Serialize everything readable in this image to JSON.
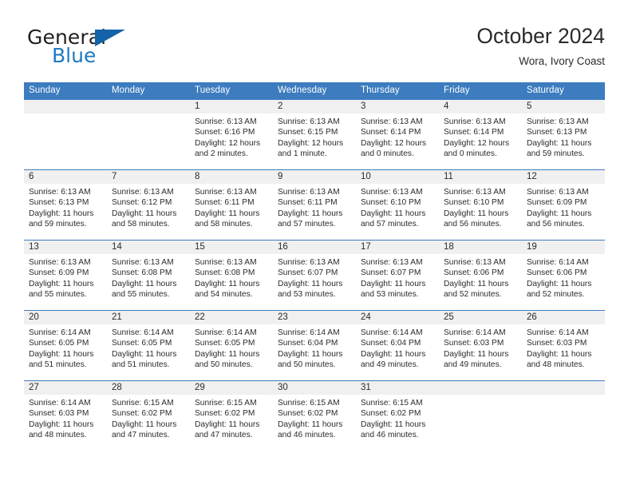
{
  "brand": {
    "name_part1": "General",
    "name_part2": "Blue",
    "triangle_color": "#1263a8",
    "blue_color": "#1e7ac4"
  },
  "header": {
    "month_title": "October 2024",
    "location": "Wora, Ivory Coast"
  },
  "theme": {
    "header_bar_color": "#3c7cbf",
    "daynum_band_color": "#f0f0f0",
    "text_color": "#2b2b2b"
  },
  "weekday_headers": [
    "Sunday",
    "Monday",
    "Tuesday",
    "Wednesday",
    "Thursday",
    "Friday",
    "Saturday"
  ],
  "weeks": [
    [
      {
        "day": "",
        "sunrise": "",
        "sunset": "",
        "daylight_line1": "",
        "daylight_line2": "",
        "empty": true
      },
      {
        "day": "",
        "sunrise": "",
        "sunset": "",
        "daylight_line1": "",
        "daylight_line2": "",
        "empty": true
      },
      {
        "day": "1",
        "sunrise": "Sunrise: 6:13 AM",
        "sunset": "Sunset: 6:16 PM",
        "daylight_line1": "Daylight: 12 hours",
        "daylight_line2": "and 2 minutes."
      },
      {
        "day": "2",
        "sunrise": "Sunrise: 6:13 AM",
        "sunset": "Sunset: 6:15 PM",
        "daylight_line1": "Daylight: 12 hours",
        "daylight_line2": "and 1 minute."
      },
      {
        "day": "3",
        "sunrise": "Sunrise: 6:13 AM",
        "sunset": "Sunset: 6:14 PM",
        "daylight_line1": "Daylight: 12 hours",
        "daylight_line2": "and 0 minutes."
      },
      {
        "day": "4",
        "sunrise": "Sunrise: 6:13 AM",
        "sunset": "Sunset: 6:14 PM",
        "daylight_line1": "Daylight: 12 hours",
        "daylight_line2": "and 0 minutes."
      },
      {
        "day": "5",
        "sunrise": "Sunrise: 6:13 AM",
        "sunset": "Sunset: 6:13 PM",
        "daylight_line1": "Daylight: 11 hours",
        "daylight_line2": "and 59 minutes."
      }
    ],
    [
      {
        "day": "6",
        "sunrise": "Sunrise: 6:13 AM",
        "sunset": "Sunset: 6:13 PM",
        "daylight_line1": "Daylight: 11 hours",
        "daylight_line2": "and 59 minutes."
      },
      {
        "day": "7",
        "sunrise": "Sunrise: 6:13 AM",
        "sunset": "Sunset: 6:12 PM",
        "daylight_line1": "Daylight: 11 hours",
        "daylight_line2": "and 58 minutes."
      },
      {
        "day": "8",
        "sunrise": "Sunrise: 6:13 AM",
        "sunset": "Sunset: 6:11 PM",
        "daylight_line1": "Daylight: 11 hours",
        "daylight_line2": "and 58 minutes."
      },
      {
        "day": "9",
        "sunrise": "Sunrise: 6:13 AM",
        "sunset": "Sunset: 6:11 PM",
        "daylight_line1": "Daylight: 11 hours",
        "daylight_line2": "and 57 minutes."
      },
      {
        "day": "10",
        "sunrise": "Sunrise: 6:13 AM",
        "sunset": "Sunset: 6:10 PM",
        "daylight_line1": "Daylight: 11 hours",
        "daylight_line2": "and 57 minutes."
      },
      {
        "day": "11",
        "sunrise": "Sunrise: 6:13 AM",
        "sunset": "Sunset: 6:10 PM",
        "daylight_line1": "Daylight: 11 hours",
        "daylight_line2": "and 56 minutes."
      },
      {
        "day": "12",
        "sunrise": "Sunrise: 6:13 AM",
        "sunset": "Sunset: 6:09 PM",
        "daylight_line1": "Daylight: 11 hours",
        "daylight_line2": "and 56 minutes."
      }
    ],
    [
      {
        "day": "13",
        "sunrise": "Sunrise: 6:13 AM",
        "sunset": "Sunset: 6:09 PM",
        "daylight_line1": "Daylight: 11 hours",
        "daylight_line2": "and 55 minutes."
      },
      {
        "day": "14",
        "sunrise": "Sunrise: 6:13 AM",
        "sunset": "Sunset: 6:08 PM",
        "daylight_line1": "Daylight: 11 hours",
        "daylight_line2": "and 55 minutes."
      },
      {
        "day": "15",
        "sunrise": "Sunrise: 6:13 AM",
        "sunset": "Sunset: 6:08 PM",
        "daylight_line1": "Daylight: 11 hours",
        "daylight_line2": "and 54 minutes."
      },
      {
        "day": "16",
        "sunrise": "Sunrise: 6:13 AM",
        "sunset": "Sunset: 6:07 PM",
        "daylight_line1": "Daylight: 11 hours",
        "daylight_line2": "and 53 minutes."
      },
      {
        "day": "17",
        "sunrise": "Sunrise: 6:13 AM",
        "sunset": "Sunset: 6:07 PM",
        "daylight_line1": "Daylight: 11 hours",
        "daylight_line2": "and 53 minutes."
      },
      {
        "day": "18",
        "sunrise": "Sunrise: 6:13 AM",
        "sunset": "Sunset: 6:06 PM",
        "daylight_line1": "Daylight: 11 hours",
        "daylight_line2": "and 52 minutes."
      },
      {
        "day": "19",
        "sunrise": "Sunrise: 6:14 AM",
        "sunset": "Sunset: 6:06 PM",
        "daylight_line1": "Daylight: 11 hours",
        "daylight_line2": "and 52 minutes."
      }
    ],
    [
      {
        "day": "20",
        "sunrise": "Sunrise: 6:14 AM",
        "sunset": "Sunset: 6:05 PM",
        "daylight_line1": "Daylight: 11 hours",
        "daylight_line2": "and 51 minutes."
      },
      {
        "day": "21",
        "sunrise": "Sunrise: 6:14 AM",
        "sunset": "Sunset: 6:05 PM",
        "daylight_line1": "Daylight: 11 hours",
        "daylight_line2": "and 51 minutes."
      },
      {
        "day": "22",
        "sunrise": "Sunrise: 6:14 AM",
        "sunset": "Sunset: 6:05 PM",
        "daylight_line1": "Daylight: 11 hours",
        "daylight_line2": "and 50 minutes."
      },
      {
        "day": "23",
        "sunrise": "Sunrise: 6:14 AM",
        "sunset": "Sunset: 6:04 PM",
        "daylight_line1": "Daylight: 11 hours",
        "daylight_line2": "and 50 minutes."
      },
      {
        "day": "24",
        "sunrise": "Sunrise: 6:14 AM",
        "sunset": "Sunset: 6:04 PM",
        "daylight_line1": "Daylight: 11 hours",
        "daylight_line2": "and 49 minutes."
      },
      {
        "day": "25",
        "sunrise": "Sunrise: 6:14 AM",
        "sunset": "Sunset: 6:03 PM",
        "daylight_line1": "Daylight: 11 hours",
        "daylight_line2": "and 49 minutes."
      },
      {
        "day": "26",
        "sunrise": "Sunrise: 6:14 AM",
        "sunset": "Sunset: 6:03 PM",
        "daylight_line1": "Daylight: 11 hours",
        "daylight_line2": "and 48 minutes."
      }
    ],
    [
      {
        "day": "27",
        "sunrise": "Sunrise: 6:14 AM",
        "sunset": "Sunset: 6:03 PM",
        "daylight_line1": "Daylight: 11 hours",
        "daylight_line2": "and 48 minutes."
      },
      {
        "day": "28",
        "sunrise": "Sunrise: 6:15 AM",
        "sunset": "Sunset: 6:02 PM",
        "daylight_line1": "Daylight: 11 hours",
        "daylight_line2": "and 47 minutes."
      },
      {
        "day": "29",
        "sunrise": "Sunrise: 6:15 AM",
        "sunset": "Sunset: 6:02 PM",
        "daylight_line1": "Daylight: 11 hours",
        "daylight_line2": "and 47 minutes."
      },
      {
        "day": "30",
        "sunrise": "Sunrise: 6:15 AM",
        "sunset": "Sunset: 6:02 PM",
        "daylight_line1": "Daylight: 11 hours",
        "daylight_line2": "and 46 minutes."
      },
      {
        "day": "31",
        "sunrise": "Sunrise: 6:15 AM",
        "sunset": "Sunset: 6:02 PM",
        "daylight_line1": "Daylight: 11 hours",
        "daylight_line2": "and 46 minutes."
      },
      {
        "day": "",
        "sunrise": "",
        "sunset": "",
        "daylight_line1": "",
        "daylight_line2": "",
        "empty": true
      },
      {
        "day": "",
        "sunrise": "",
        "sunset": "",
        "daylight_line1": "",
        "daylight_line2": "",
        "empty": true
      }
    ]
  ]
}
